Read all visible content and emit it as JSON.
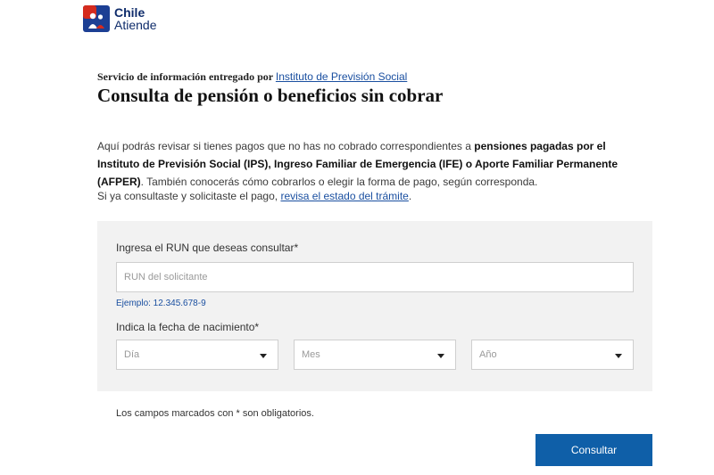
{
  "header": {
    "logo_line1": "Chile",
    "logo_line2": "Atiende"
  },
  "service": {
    "prefix": "Servicio de información entregado por",
    "link": "Instituto de Previsión Social"
  },
  "title": "Consulta de pensión o beneficios sin cobrar",
  "intro": {
    "p1_a": "Aquí podrás revisar si tienes pagos que no has no cobrado correspondientes a ",
    "p1_b": "pensiones pagadas por el Instituto de Previsión Social (IPS), Ingreso Familiar de Emergencia (IFE) o Aporte Familiar Permanente (AFPER)",
    "p1_c": ". También conocerás cómo cobrarlos o elegir la forma de pago, según corresponda.",
    "p2_a": "Si ya consultaste y solicitaste el pago, ",
    "p2_link": "revisa el estado del trámite",
    "p2_b": "."
  },
  "form": {
    "run_label": "Ingresa el RUN que deseas consultar*",
    "run_placeholder": "RUN del solicitante",
    "run_hint": "Ejemplo: 12.345.678-9",
    "date_label": "Indica la fecha de nacimiento*",
    "day": "Día",
    "month": "Mes",
    "year": "Año"
  },
  "required_note": "Los campos marcados con * son obligatorios.",
  "submit_label": "Consultar",
  "colors": {
    "brand_blue": "#0f5fa8",
    "brand_red": "#d52b1e",
    "link": "#1a4fa0",
    "panel": "#f2f2f2"
  }
}
